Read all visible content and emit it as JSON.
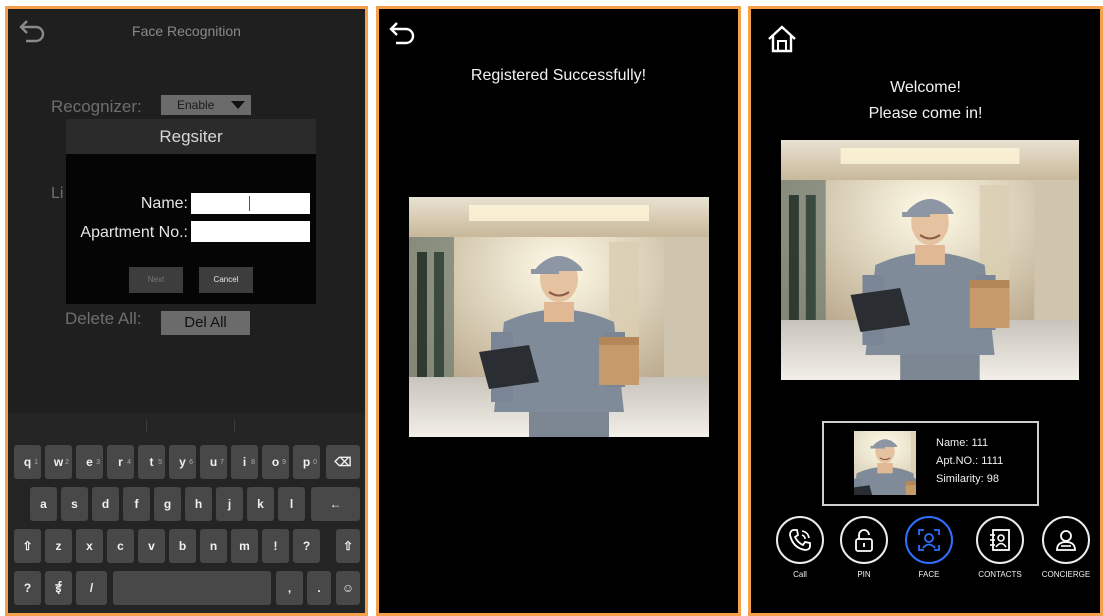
{
  "panel1": {
    "title": "Face Recognition",
    "recognizer_label": "Recognizer:",
    "recognizer_value": "Enable",
    "hidden_label_fragment": "Li",
    "delete_all_label": "Delete All:",
    "delete_all_button": "Del All",
    "dialog": {
      "title": "Regsiter",
      "name_label": "Name:",
      "name_value": "",
      "apartment_label": "Apartment No.:",
      "apartment_value": "",
      "next_button": "Next",
      "cancel_button": "Cancel"
    },
    "keyboard": {
      "row1": [
        {
          "k": "q",
          "n": "1"
        },
        {
          "k": "w",
          "n": "2"
        },
        {
          "k": "e",
          "n": "3"
        },
        {
          "k": "r",
          "n": "4"
        },
        {
          "k": "t",
          "n": "5"
        },
        {
          "k": "y",
          "n": "6"
        },
        {
          "k": "u",
          "n": "7"
        },
        {
          "k": "i",
          "n": "8"
        },
        {
          "k": "o",
          "n": "9"
        },
        {
          "k": "p",
          "n": "0"
        }
      ],
      "row2": [
        "a",
        "s",
        "d",
        "f",
        "g",
        "h",
        "j",
        "k",
        "l"
      ],
      "row3": [
        "z",
        "x",
        "c",
        "v",
        "b",
        "n",
        "m",
        "!",
        "?"
      ],
      "mode_key": "?123",
      "lang_key": "ई",
      "slash_key": "/",
      "comma_key": ",",
      "period_key": ".",
      "backspace_icon": "⌫",
      "enter_icon": "←",
      "shift_icon": "⇧",
      "emoji_icon": "☺"
    }
  },
  "panel2": {
    "message": "Registered Successfully!"
  },
  "panel3": {
    "welcome": "Welcome!",
    "come_in": "Please come in!",
    "name": "Name: 111",
    "apt": "Apt.NO.: 1111",
    "similarity": "Similarity: 98",
    "nav": [
      {
        "label": "Call",
        "icon": "phone-icon"
      },
      {
        "label": "PIN",
        "icon": "lock-icon"
      },
      {
        "label": "FACE",
        "icon": "face-scan-icon"
      },
      {
        "label": "CONTACTS",
        "icon": "contacts-icon"
      },
      {
        "label": "CONCIERGE",
        "icon": "concierge-icon"
      }
    ]
  },
  "colors": {
    "frame": "#f5a04a",
    "active_nav": "#2f6fff",
    "panel1_bg": "#1f1f1f"
  }
}
